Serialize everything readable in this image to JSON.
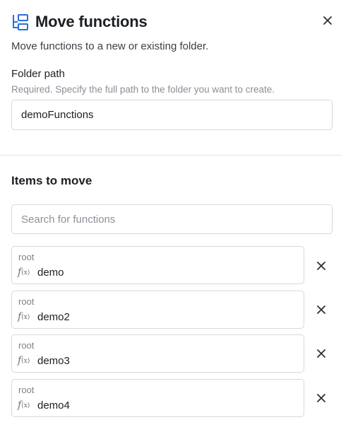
{
  "header": {
    "title": "Move functions",
    "logo_icon": "folder-tree-icon",
    "close_icon": "close-icon"
  },
  "subtitle": "Move functions to a new or existing folder.",
  "folder_field": {
    "label": "Folder path",
    "hint": "Required. Specify the full path to the folder you want to create.",
    "value": "demoFunctions"
  },
  "items_section": {
    "title": "Items to move",
    "search_placeholder": "Search for functions",
    "items": [
      {
        "parent": "root",
        "icon": "function-icon",
        "icon_text": "f",
        "icon_sub": "(x)",
        "name": "demo"
      },
      {
        "parent": "root",
        "icon": "function-icon",
        "icon_text": "f",
        "icon_sub": "(x)",
        "name": "demo2"
      },
      {
        "parent": "root",
        "icon": "function-icon",
        "icon_text": "f",
        "icon_sub": "(x)",
        "name": "demo3"
      },
      {
        "parent": "root",
        "icon": "function-icon",
        "icon_text": "f",
        "icon_sub": "(x)",
        "name": "demo4"
      }
    ]
  },
  "colors": {
    "accent": "#2a6fdb",
    "border": "#d6d8db",
    "text": "#1c1f24",
    "muted": "#8a8f96"
  }
}
